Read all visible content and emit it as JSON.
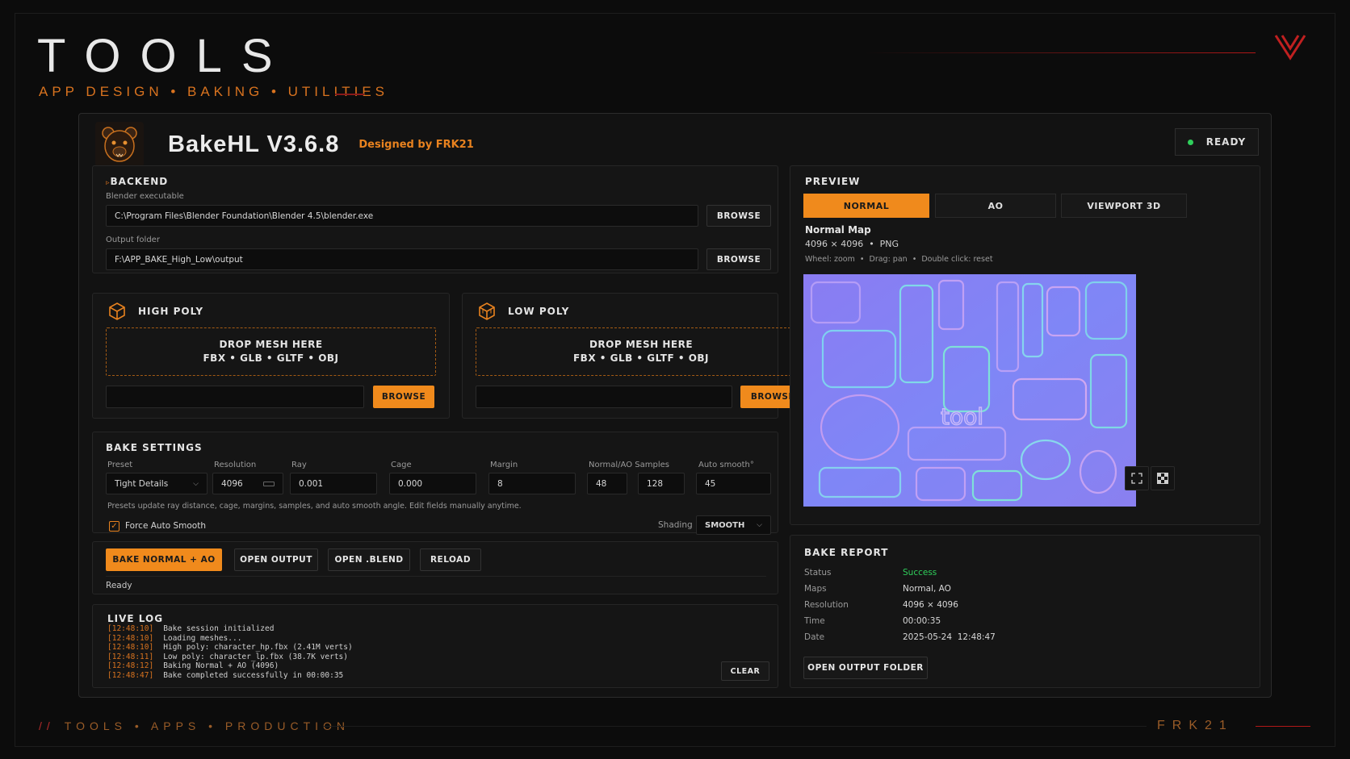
{
  "hero": {
    "title": "TOOLS",
    "subtitle": "APP DESIGN • BAKING • UTILITIES",
    "footer_left": "TOOLS • APPS • PRODUCTION",
    "footer_slashes": "//",
    "footer_right": "FRK21"
  },
  "app": {
    "title": "BakeHL V3.6.8",
    "designed_by": "Designed by FRK21",
    "status": "READY",
    "colors": {
      "accent": "#f08a1c",
      "ready": "#2fcf5b",
      "success": "#2fcf5b"
    }
  },
  "backend": {
    "title": "BACKEND",
    "blender_label": "Blender executable",
    "blender_path": "C:\\Program Files\\Blender Foundation\\Blender 4.5\\blender.exe",
    "output_label": "Output folder",
    "output_path": "F:\\APP_BAKE_High_Low\\output",
    "browse_label": "BROWSE"
  },
  "high_poly": {
    "title": "HIGH POLY",
    "drop_line1": "DROP MESH HERE",
    "drop_line2": "FBX • GLB • GLTF • OBJ",
    "browse_label": "BROWSE"
  },
  "low_poly": {
    "title": "LOW POLY",
    "drop_line1": "DROP MESH HERE",
    "drop_line2": "FBX • GLB • GLTF • OBJ",
    "browse_label": "BROWSE"
  },
  "bake_settings": {
    "title": "BAKE SETTINGS",
    "preset_label": "Preset",
    "preset_value": "Tight Details",
    "resolution_label": "Resolution",
    "resolution_value": "4096",
    "ray_label": "Ray",
    "ray_value": "0.001",
    "cage_label": "Cage",
    "cage_value": "0.000",
    "margin_label": "Margin",
    "margin_value": "8",
    "samples_label": "Normal/AO Samples",
    "normal_samples": "48",
    "ao_samples": "128",
    "auto_smooth_label": "Auto smooth°",
    "auto_smooth_value": "45",
    "hint": "Presets update ray distance, cage, margins, samples, and auto smooth angle. Edit fields manually anytime.",
    "force_auto_smooth": "Force Auto Smooth",
    "shading_label": "Shading",
    "shading_value": "SMOOTH"
  },
  "actions": {
    "bake": "BAKE NORMAL + AO",
    "open_output": "OPEN OUTPUT",
    "open_blend": "OPEN .BLEND",
    "reload": "RELOAD",
    "status": "Ready"
  },
  "log": {
    "title": "LIVE LOG",
    "clear": "CLEAR",
    "lines": [
      {
        "ts": "[12:48:10]",
        "msg": "Bake session initialized"
      },
      {
        "ts": "[12:48:10]",
        "msg": "Loading meshes..."
      },
      {
        "ts": "[12:48:10]",
        "msg": "High poly: character_hp.fbx (2.41M verts)"
      },
      {
        "ts": "[12:48:11]",
        "msg": "Low poly: character_lp.fbx (38.7K verts)"
      },
      {
        "ts": "[12:48:12]",
        "msg": "Baking Normal + AO (4096)"
      },
      {
        "ts": "[12:48:47]",
        "msg": "Bake completed successfully in 00:00:35"
      }
    ]
  },
  "preview": {
    "title": "PREVIEW",
    "tabs": [
      "NORMAL",
      "AO",
      "VIEWPORT 3D"
    ],
    "map_name": "Normal Map",
    "map_info": "4096 × 4096  •  PNG",
    "controls_hint": "Wheel: zoom  •  Drag: pan  •  Double click: reset"
  },
  "report": {
    "title": "BAKE REPORT",
    "rows": [
      {
        "k": "Status",
        "v": "Success"
      },
      {
        "k": "Maps",
        "v": "Normal, AO"
      },
      {
        "k": "Resolution",
        "v": "4096 × 4096"
      },
      {
        "k": "Time",
        "v": "00:00:35"
      },
      {
        "k": "Date",
        "v": "2025-05-24  12:48:47"
      }
    ],
    "open_folder": "OPEN OUTPUT FOLDER"
  }
}
